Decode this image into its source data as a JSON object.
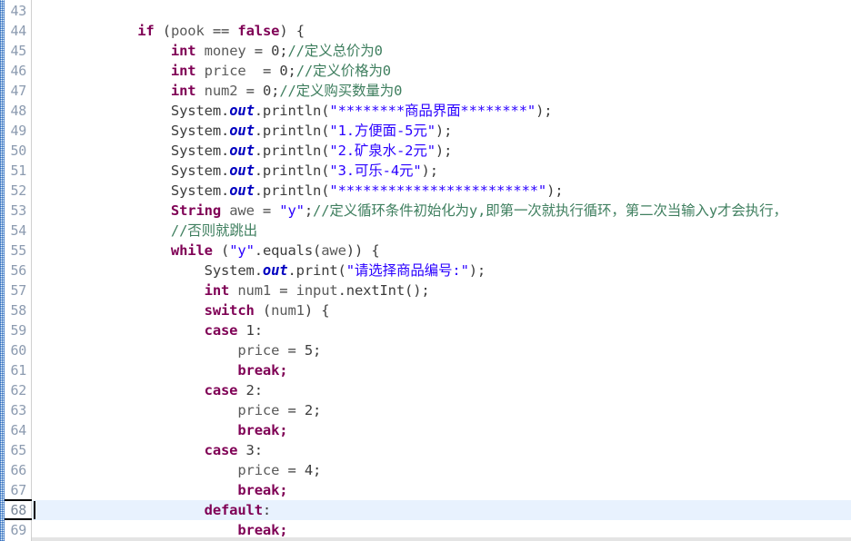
{
  "editor": {
    "app": "java-code-editor",
    "language": "java",
    "first_line": 43,
    "cursor_line": 68,
    "colors": {
      "keyword": "#7F0055",
      "string": "#2A00FF",
      "comment": "#3F7F5F",
      "static_field": "#0000C0",
      "plain": "#3C3C3C",
      "line_number": "#8C9BB0",
      "current_line_bg": "#E8F2FE",
      "background": "#FFFFFF"
    }
  },
  "lines": [
    {
      "n": 43,
      "tokens": []
    },
    {
      "n": 44,
      "tokens": [
        {
          "t": "            ",
          "c": "pln"
        },
        {
          "t": "if",
          "c": "kw"
        },
        {
          "t": " (",
          "c": "pln"
        },
        {
          "t": "pook",
          "c": "var"
        },
        {
          "t": " == ",
          "c": "pln"
        },
        {
          "t": "false",
          "c": "kw"
        },
        {
          "t": ") {",
          "c": "pln"
        }
      ]
    },
    {
      "n": 45,
      "tokens": [
        {
          "t": "                ",
          "c": "pln"
        },
        {
          "t": "int",
          "c": "kw"
        },
        {
          "t": " ",
          "c": "pln"
        },
        {
          "t": "money",
          "c": "var"
        },
        {
          "t": " = ",
          "c": "pln"
        },
        {
          "t": "0;",
          "c": "pln"
        },
        {
          "t": "//定义总价为0",
          "c": "cmt"
        }
      ]
    },
    {
      "n": 46,
      "tokens": [
        {
          "t": "                ",
          "c": "pln"
        },
        {
          "t": "int",
          "c": "kw"
        },
        {
          "t": " ",
          "c": "pln"
        },
        {
          "t": "price",
          "c": "var"
        },
        {
          "t": "  = ",
          "c": "pln"
        },
        {
          "t": "0;",
          "c": "pln"
        },
        {
          "t": "//定义价格为0",
          "c": "cmt"
        }
      ]
    },
    {
      "n": 47,
      "tokens": [
        {
          "t": "                ",
          "c": "pln"
        },
        {
          "t": "int",
          "c": "kw"
        },
        {
          "t": " ",
          "c": "pln"
        },
        {
          "t": "num2",
          "c": "var"
        },
        {
          "t": " = ",
          "c": "pln"
        },
        {
          "t": "0;",
          "c": "pln"
        },
        {
          "t": "//定义购买数量为0",
          "c": "cmt"
        }
      ]
    },
    {
      "n": 48,
      "tokens": [
        {
          "t": "                ",
          "c": "pln"
        },
        {
          "t": "System.",
          "c": "pln"
        },
        {
          "t": "out",
          "c": "fld"
        },
        {
          "t": ".println(",
          "c": "pln"
        },
        {
          "t": "\"********商品界面********\"",
          "c": "str"
        },
        {
          "t": ");",
          "c": "pln"
        }
      ]
    },
    {
      "n": 49,
      "tokens": [
        {
          "t": "                ",
          "c": "pln"
        },
        {
          "t": "System.",
          "c": "pln"
        },
        {
          "t": "out",
          "c": "fld"
        },
        {
          "t": ".println(",
          "c": "pln"
        },
        {
          "t": "\"1.方便面-5元\"",
          "c": "str"
        },
        {
          "t": ");",
          "c": "pln"
        }
      ]
    },
    {
      "n": 50,
      "tokens": [
        {
          "t": "                ",
          "c": "pln"
        },
        {
          "t": "System.",
          "c": "pln"
        },
        {
          "t": "out",
          "c": "fld"
        },
        {
          "t": ".println(",
          "c": "pln"
        },
        {
          "t": "\"2.矿泉水-2元\"",
          "c": "str"
        },
        {
          "t": ");",
          "c": "pln"
        }
      ]
    },
    {
      "n": 51,
      "tokens": [
        {
          "t": "                ",
          "c": "pln"
        },
        {
          "t": "System.",
          "c": "pln"
        },
        {
          "t": "out",
          "c": "fld"
        },
        {
          "t": ".println(",
          "c": "pln"
        },
        {
          "t": "\"3.可乐-4元\"",
          "c": "str"
        },
        {
          "t": ");",
          "c": "pln"
        }
      ]
    },
    {
      "n": 52,
      "tokens": [
        {
          "t": "                ",
          "c": "pln"
        },
        {
          "t": "System.",
          "c": "pln"
        },
        {
          "t": "out",
          "c": "fld"
        },
        {
          "t": ".println(",
          "c": "pln"
        },
        {
          "t": "\"************************\"",
          "c": "str"
        },
        {
          "t": ");",
          "c": "pln"
        }
      ]
    },
    {
      "n": 53,
      "tokens": [
        {
          "t": "                ",
          "c": "pln"
        },
        {
          "t": "String",
          "c": "kw"
        },
        {
          "t": " ",
          "c": "pln"
        },
        {
          "t": "awe",
          "c": "var"
        },
        {
          "t": " = ",
          "c": "pln"
        },
        {
          "t": "\"y\"",
          "c": "str"
        },
        {
          "t": ";",
          "c": "pln"
        },
        {
          "t": "//定义循环条件初始化为y,即第一次就执行循环，第二次当输入y才会执行，",
          "c": "cmt"
        }
      ]
    },
    {
      "n": 54,
      "tokens": [
        {
          "t": "                ",
          "c": "pln"
        },
        {
          "t": "//否则就跳出",
          "c": "cmt"
        }
      ]
    },
    {
      "n": 55,
      "tokens": [
        {
          "t": "                ",
          "c": "pln"
        },
        {
          "t": "while",
          "c": "kw"
        },
        {
          "t": " (",
          "c": "pln"
        },
        {
          "t": "\"y\"",
          "c": "str"
        },
        {
          "t": ".equals(",
          "c": "pln"
        },
        {
          "t": "awe",
          "c": "var"
        },
        {
          "t": ")) {",
          "c": "pln"
        }
      ]
    },
    {
      "n": 56,
      "tokens": [
        {
          "t": "                    ",
          "c": "pln"
        },
        {
          "t": "System.",
          "c": "pln"
        },
        {
          "t": "out",
          "c": "fld"
        },
        {
          "t": ".print(",
          "c": "pln"
        },
        {
          "t": "\"请选择商品编号:\"",
          "c": "str"
        },
        {
          "t": ");",
          "c": "pln"
        }
      ]
    },
    {
      "n": 57,
      "tokens": [
        {
          "t": "                    ",
          "c": "pln"
        },
        {
          "t": "int",
          "c": "kw"
        },
        {
          "t": " ",
          "c": "pln"
        },
        {
          "t": "num1",
          "c": "var"
        },
        {
          "t": " = ",
          "c": "pln"
        },
        {
          "t": "input",
          "c": "var"
        },
        {
          "t": ".nextInt();",
          "c": "pln"
        }
      ]
    },
    {
      "n": 58,
      "tokens": [
        {
          "t": "                    ",
          "c": "pln"
        },
        {
          "t": "switch",
          "c": "kw"
        },
        {
          "t": " (",
          "c": "pln"
        },
        {
          "t": "num1",
          "c": "var"
        },
        {
          "t": ") {",
          "c": "pln"
        }
      ]
    },
    {
      "n": 59,
      "tokens": [
        {
          "t": "                    ",
          "c": "pln"
        },
        {
          "t": "case",
          "c": "kw"
        },
        {
          "t": " 1:",
          "c": "pln"
        }
      ]
    },
    {
      "n": 60,
      "tokens": [
        {
          "t": "                        ",
          "c": "pln"
        },
        {
          "t": "price",
          "c": "var"
        },
        {
          "t": " = 5;",
          "c": "pln"
        }
      ]
    },
    {
      "n": 61,
      "tokens": [
        {
          "t": "                        ",
          "c": "pln"
        },
        {
          "t": "break;",
          "c": "kw"
        }
      ]
    },
    {
      "n": 62,
      "tokens": [
        {
          "t": "                    ",
          "c": "pln"
        },
        {
          "t": "case",
          "c": "kw"
        },
        {
          "t": " 2:",
          "c": "pln"
        }
      ]
    },
    {
      "n": 63,
      "tokens": [
        {
          "t": "                        ",
          "c": "pln"
        },
        {
          "t": "price",
          "c": "var"
        },
        {
          "t": " = 2;",
          "c": "pln"
        }
      ]
    },
    {
      "n": 64,
      "tokens": [
        {
          "t": "                        ",
          "c": "pln"
        },
        {
          "t": "break;",
          "c": "kw"
        }
      ]
    },
    {
      "n": 65,
      "tokens": [
        {
          "t": "                    ",
          "c": "pln"
        },
        {
          "t": "case",
          "c": "kw"
        },
        {
          "t": " 3:",
          "c": "pln"
        }
      ]
    },
    {
      "n": 66,
      "tokens": [
        {
          "t": "                        ",
          "c": "pln"
        },
        {
          "t": "price",
          "c": "var"
        },
        {
          "t": " = 4;",
          "c": "pln"
        }
      ]
    },
    {
      "n": 67,
      "tokens": [
        {
          "t": "                        ",
          "c": "pln"
        },
        {
          "t": "break;",
          "c": "kw"
        }
      ]
    },
    {
      "n": 68,
      "highlight": true,
      "tokens": [
        {
          "t": "                    ",
          "c": "pln"
        },
        {
          "t": "default",
          "c": "kw"
        },
        {
          "t": ":",
          "c": "pln"
        }
      ]
    },
    {
      "n": 69,
      "tokens": [
        {
          "t": "                        ",
          "c": "pln"
        },
        {
          "t": "break;",
          "c": "kw"
        }
      ]
    }
  ]
}
